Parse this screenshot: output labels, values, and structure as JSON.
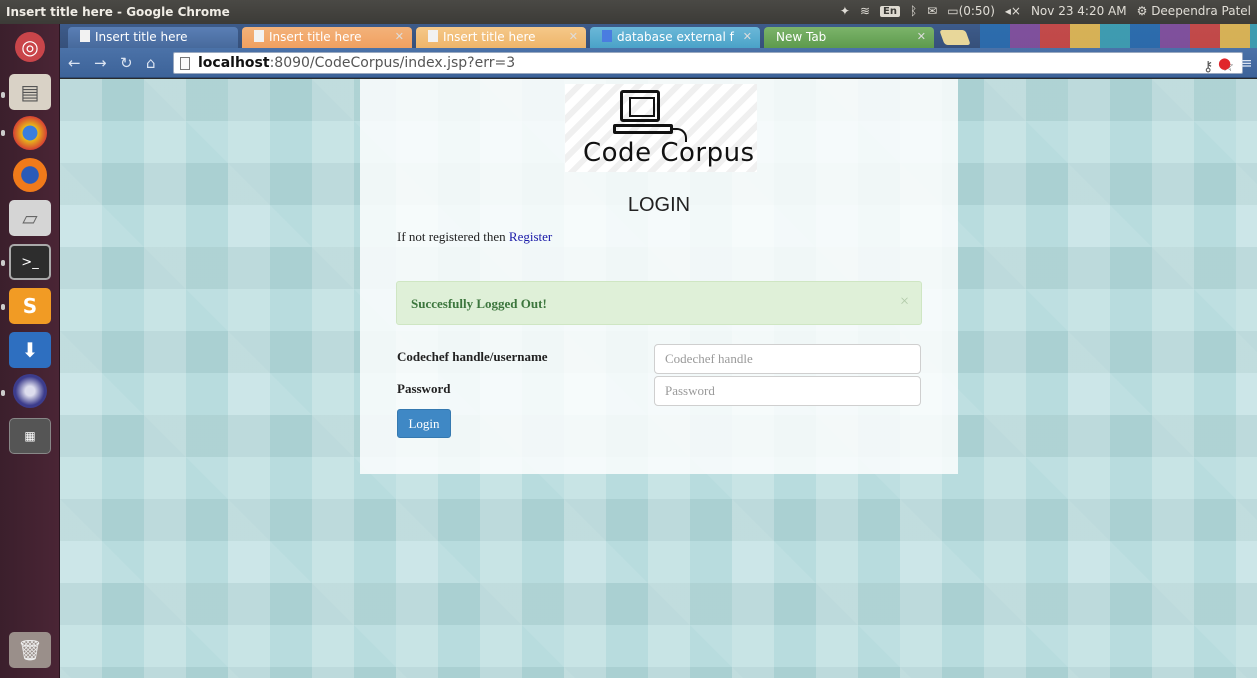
{
  "window": {
    "title": "Insert title here - Google Chrome"
  },
  "panel": {
    "keyboard_layout": "En",
    "battery": "(0:50)",
    "datetime": "Nov 23  4:20 AM",
    "user": "Deependra Patel"
  },
  "tabs": [
    {
      "label": "Insert title here",
      "active": true
    },
    {
      "label": "Insert title here"
    },
    {
      "label": "Insert title here"
    },
    {
      "label": "database external f"
    },
    {
      "label": "New Tab"
    }
  ],
  "address_bar": {
    "host": "localhost",
    "rest": ":8090/CodeCorpus/index.jsp?err=3"
  },
  "page": {
    "logo_text": "Code Corpus",
    "heading": "LOGIN",
    "register_prompt": "If not registered then ",
    "register_link": "Register",
    "alert_message": "Succesfully Logged Out!",
    "alert_close": "×",
    "username_label": "Codechef handle/username",
    "username_placeholder": "Codechef handle",
    "password_label": "Password",
    "password_placeholder": "Password",
    "login_button": "Login"
  },
  "colors": {
    "alert_bg": "#dff0d8",
    "alert_text": "#3c763d",
    "button_bg": "#3f88c5",
    "link": "#1a1aa8"
  },
  "icons": [
    "ubuntu-dash-icon",
    "files-icon",
    "chrome-icon",
    "firefox-icon",
    "drive-icon",
    "terminal-icon",
    "sublime-icon",
    "download-icon",
    "eclipse-icon",
    "workspace-icon",
    "trash-icon"
  ]
}
